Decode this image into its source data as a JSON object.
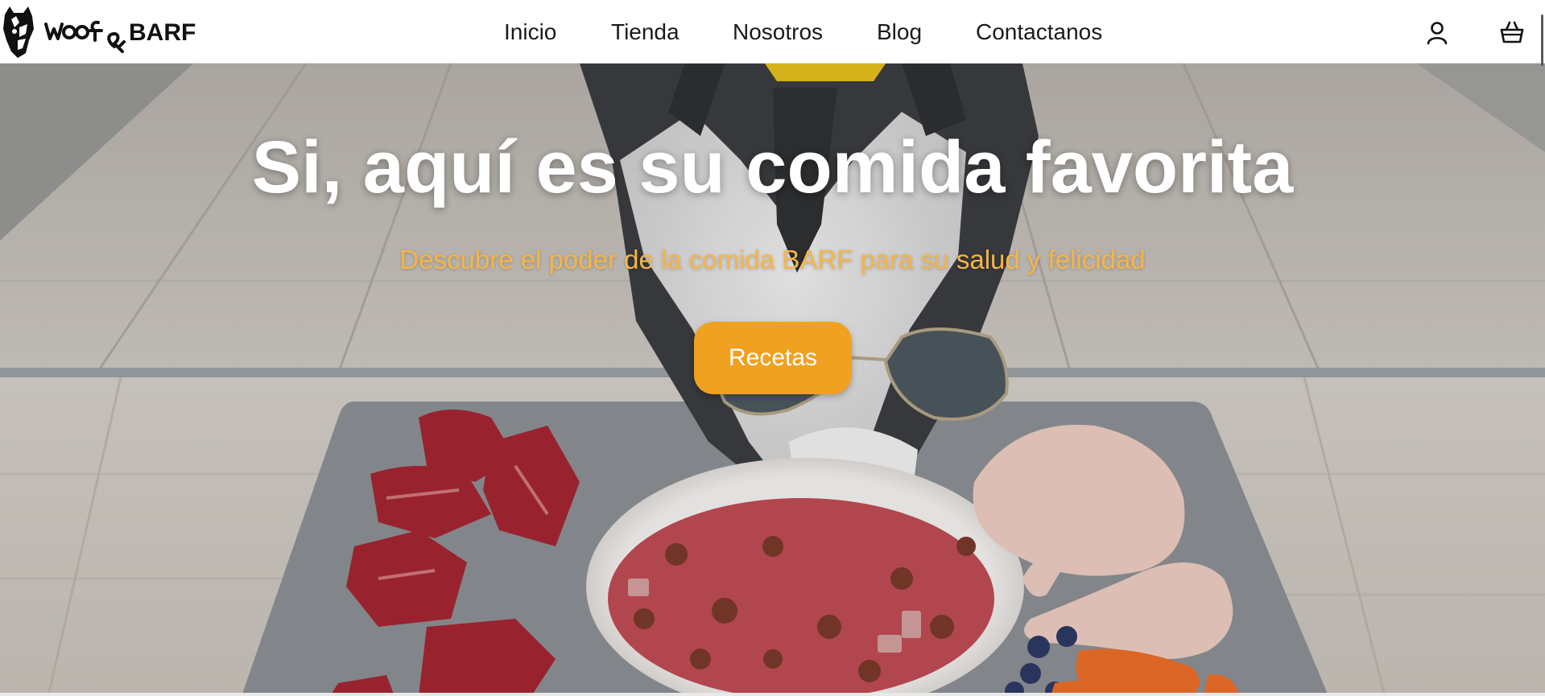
{
  "header": {
    "logo_text": "Woof&BARF",
    "nav": {
      "inicio": "Inicio",
      "tienda": "Tienda",
      "nosotros": "Nosotros",
      "blog": "Blog",
      "contactanos": "Contactanos"
    },
    "icons": [
      "user-account-icon",
      "shopping-basket-icon"
    ]
  },
  "hero": {
    "title": "Si, aquí es su comida favorita",
    "subtitle": "Descubre el poder de la comida BARF para su salud y felicidad",
    "button_label": "Recetas"
  },
  "colors": {
    "accent": "#f0a11f",
    "subtitle": "#f5b547",
    "title": "#ffffff",
    "nav_text": "#1a1a1a"
  }
}
